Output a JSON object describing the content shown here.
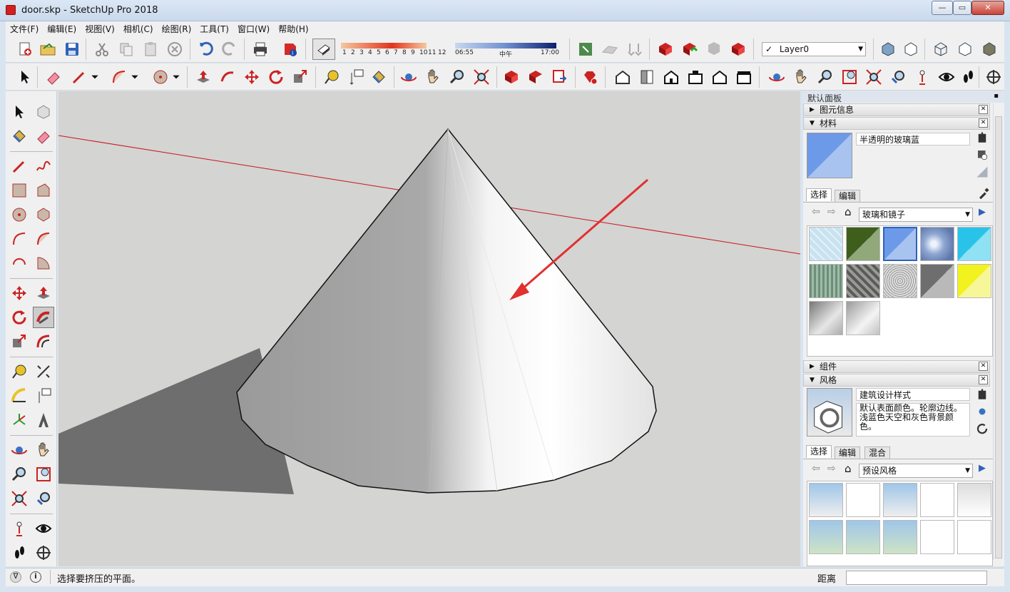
{
  "window": {
    "title": "door.skp - SketchUp Pro 2018",
    "minimize": "—",
    "maximize": "▭",
    "close": "✕"
  },
  "menu": [
    "文件(F)",
    "编辑(E)",
    "视图(V)",
    "相机(C)",
    "绘图(R)",
    "工具(T)",
    "窗口(W)",
    "帮助(H)"
  ],
  "shadow_settings": {
    "months": [
      "1",
      "2",
      "3",
      "4",
      "5",
      "6",
      "7",
      "8",
      "9",
      "10",
      "11",
      "12"
    ],
    "time_start": "06:55",
    "time_mid": "中午",
    "time_end": "17:00"
  },
  "layer": {
    "selected": "Layer0",
    "check": "✓"
  },
  "tray": {
    "title": "默认面板",
    "pin": "▪",
    "panels": {
      "entity_info": {
        "title": "图元信息"
      },
      "materials": {
        "title": "材料",
        "current_name": "半透明的玻璃蓝",
        "tabs": [
          "选择",
          "编辑"
        ],
        "library": "玻璃和镜子",
        "swatch_colors": [
          [
            "#c9e2f0",
            "#5a7f32",
            "#6d9ae8",
            "#8ea6d1",
            "#29c3ea"
          ],
          [
            "#7fa08a",
            "#70716d",
            "#b3b3b3",
            "#8e8e8e",
            "#f2f21f"
          ],
          [
            "#9a9a9a",
            "#bdbdbd"
          ]
        ]
      },
      "components": {
        "title": "组件"
      },
      "styles": {
        "title": "风格",
        "current_name": "建筑设计样式",
        "description": "默认表面颜色。轮廓边线。浅蓝色天空和灰色背景颜色。",
        "tabs": [
          "选择",
          "编辑",
          "混合"
        ],
        "library": "预设风格"
      }
    }
  },
  "status": {
    "message": "选择要挤压的平面。",
    "measure_label": "距离"
  },
  "colors": {
    "accent_red": "#e03030",
    "axis_red": "#c8141e",
    "selection_blue": "#6d9ae8"
  }
}
